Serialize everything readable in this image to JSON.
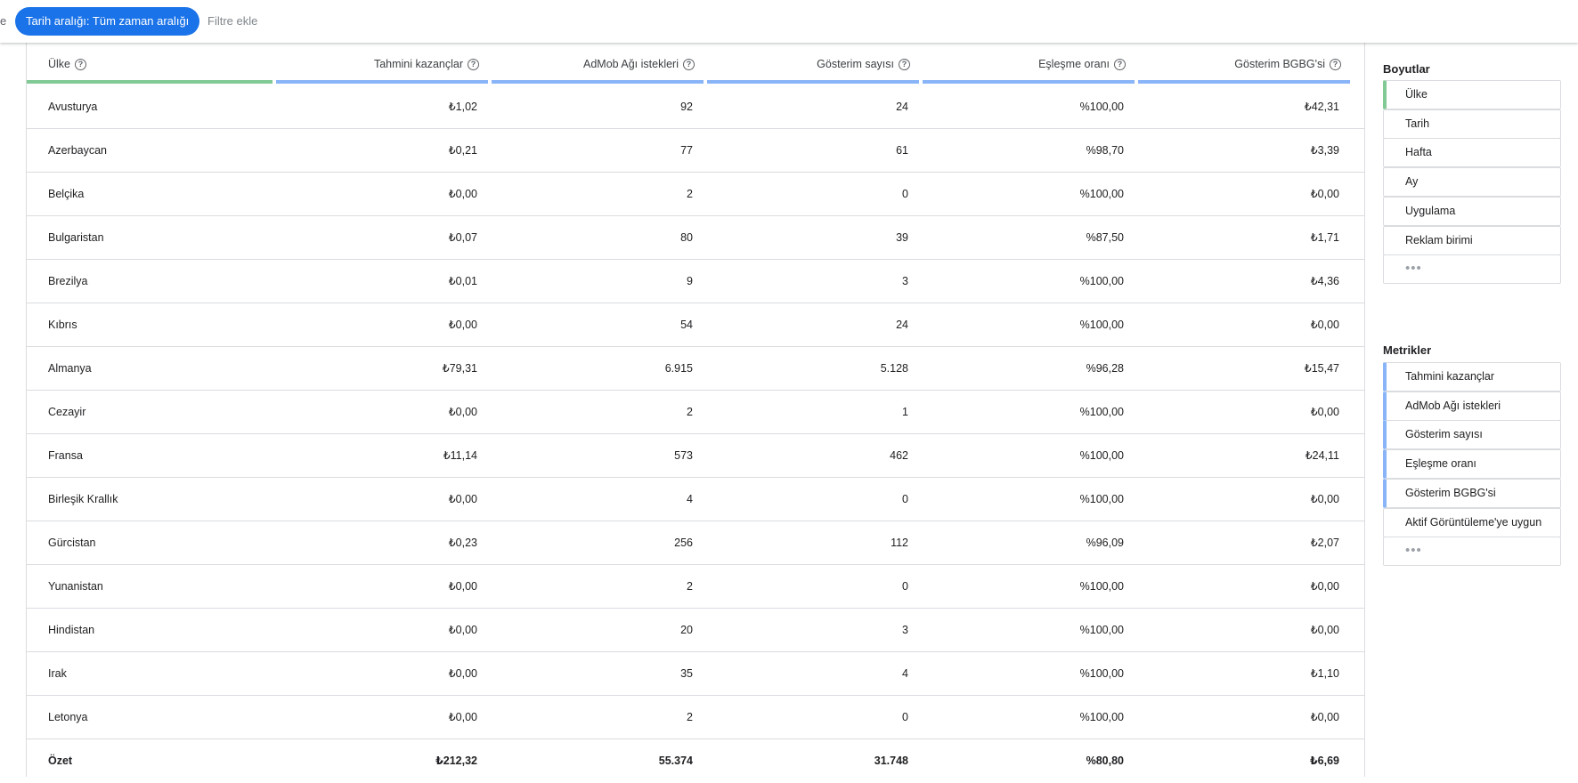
{
  "topbar": {
    "edge_char": "e",
    "date_chip": "Tarih aralığı: Tüm zaman aralığı",
    "add_filter": "Filtre ekle"
  },
  "table": {
    "columns": [
      {
        "label": "Ülke",
        "help": "?"
      },
      {
        "label": "Tahmini kazançlar",
        "help": "?"
      },
      {
        "label": "AdMob Ağı istekleri",
        "help": "?"
      },
      {
        "label": "Gösterim sayısı",
        "help": "?"
      },
      {
        "label": "Eşleşme oranı",
        "help": "?"
      },
      {
        "label": "Gösterim BGBG'si",
        "help": "?"
      }
    ],
    "rows": [
      {
        "country": "Avusturya",
        "earnings": "₺1,02",
        "requests": "92",
        "impressions": "24",
        "match_rate": "%100,00",
        "ecpm": "₺42,31"
      },
      {
        "country": "Azerbaycan",
        "earnings": "₺0,21",
        "requests": "77",
        "impressions": "61",
        "match_rate": "%98,70",
        "ecpm": "₺3,39"
      },
      {
        "country": "Belçika",
        "earnings": "₺0,00",
        "requests": "2",
        "impressions": "0",
        "match_rate": "%100,00",
        "ecpm": "₺0,00"
      },
      {
        "country": "Bulgaristan",
        "earnings": "₺0,07",
        "requests": "80",
        "impressions": "39",
        "match_rate": "%87,50",
        "ecpm": "₺1,71"
      },
      {
        "country": "Brezilya",
        "earnings": "₺0,01",
        "requests": "9",
        "impressions": "3",
        "match_rate": "%100,00",
        "ecpm": "₺4,36"
      },
      {
        "country": "Kıbrıs",
        "earnings": "₺0,00",
        "requests": "54",
        "impressions": "24",
        "match_rate": "%100,00",
        "ecpm": "₺0,00"
      },
      {
        "country": "Almanya",
        "earnings": "₺79,31",
        "requests": "6.915",
        "impressions": "5.128",
        "match_rate": "%96,28",
        "ecpm": "₺15,47"
      },
      {
        "country": "Cezayir",
        "earnings": "₺0,00",
        "requests": "2",
        "impressions": "1",
        "match_rate": "%100,00",
        "ecpm": "₺0,00"
      },
      {
        "country": "Fransa",
        "earnings": "₺11,14",
        "requests": "573",
        "impressions": "462",
        "match_rate": "%100,00",
        "ecpm": "₺24,11"
      },
      {
        "country": "Birleşik Krallık",
        "earnings": "₺0,00",
        "requests": "4",
        "impressions": "0",
        "match_rate": "%100,00",
        "ecpm": "₺0,00"
      },
      {
        "country": "Gürcistan",
        "earnings": "₺0,23",
        "requests": "256",
        "impressions": "112",
        "match_rate": "%96,09",
        "ecpm": "₺2,07"
      },
      {
        "country": "Yunanistan",
        "earnings": "₺0,00",
        "requests": "2",
        "impressions": "0",
        "match_rate": "%100,00",
        "ecpm": "₺0,00"
      },
      {
        "country": "Hindistan",
        "earnings": "₺0,00",
        "requests": "20",
        "impressions": "3",
        "match_rate": "%100,00",
        "ecpm": "₺0,00"
      },
      {
        "country": "Irak",
        "earnings": "₺0,00",
        "requests": "35",
        "impressions": "4",
        "match_rate": "%100,00",
        "ecpm": "₺1,10"
      },
      {
        "country": "Letonya",
        "earnings": "₺0,00",
        "requests": "2",
        "impressions": "0",
        "match_rate": "%100,00",
        "ecpm": "₺0,00"
      }
    ],
    "total": {
      "country": "Özet",
      "earnings": "₺212,32",
      "requests": "55.374",
      "impressions": "31.748",
      "match_rate": "%80,80",
      "ecpm": "₺6,69"
    }
  },
  "panel": {
    "dimensions_title": "Boyutlar",
    "dimensions": [
      "Ülke",
      "Tarih",
      "Hafta",
      "Ay",
      "Uygulama",
      "Reklam birimi"
    ],
    "dimensions_more": "•••",
    "metrics_title": "Metrikler",
    "metrics": [
      "Tahmini kazançlar",
      "AdMob Ağı istekleri",
      "Gösterim sayısı",
      "Eşleşme oranı",
      "Gösterim BGBG'si",
      "Aktif Görüntüleme'ye uygun"
    ],
    "metrics_more": "•••"
  },
  "colors": {
    "accent": "#1a73e8",
    "dimension_bar": "#81c995",
    "metric_bar": "#8ab4f8"
  }
}
